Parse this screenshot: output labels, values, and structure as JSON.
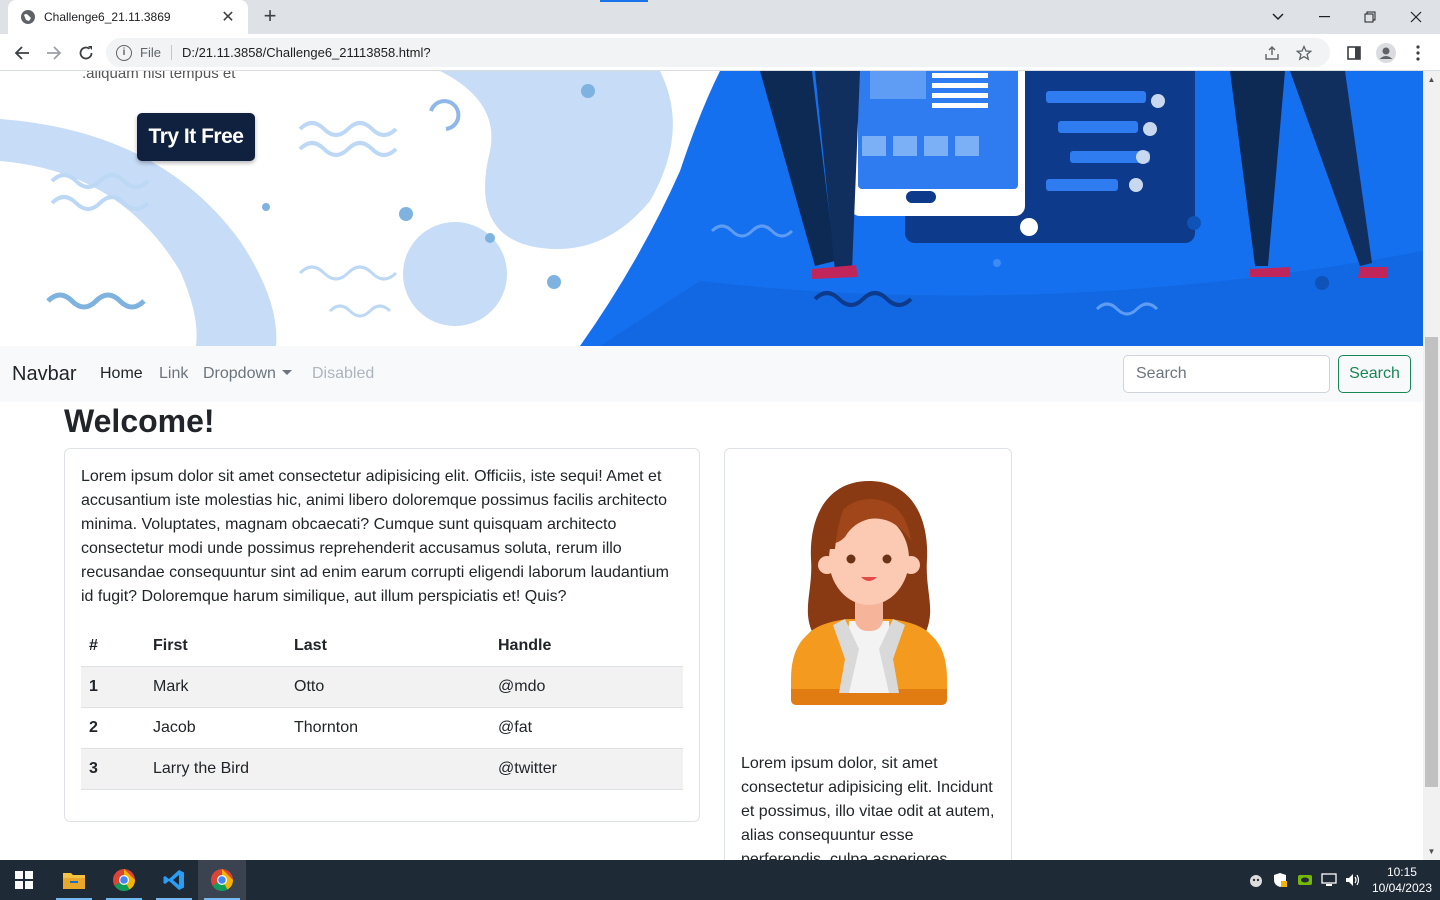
{
  "browser": {
    "tab_title": "Challenge6_21.11.3869",
    "scheme_label": "File",
    "url": "D:/21.11.3858/Challenge6_21113858.html?"
  },
  "hero": {
    "cut_text": ".aliquam nisi tempus et",
    "cta_label": "Try It Free"
  },
  "navbar": {
    "brand": "Navbar",
    "links": [
      {
        "label": "Home",
        "state": "active"
      },
      {
        "label": "Link",
        "state": "normal"
      },
      {
        "label": "Dropdown",
        "state": "dropdown"
      },
      {
        "label": "Disabled",
        "state": "disabled"
      }
    ],
    "search_placeholder": "Search",
    "search_button": "Search"
  },
  "main": {
    "heading": "Welcome!",
    "card_text": "Lorem ipsum dolor sit amet consectetur adipisicing elit. Officiis, iste sequi! Amet et accusantium iste molestias hic, animi libero doloremque possimus facilis architecto minima. Voluptates, magnam obcaecati? Cumque sunt quisquam architecto consectetur modi unde possimus reprehenderit accusamus soluta, rerum illo recusandae consequuntur sint ad enim earum corrupti eligendi laborum laudantium id fugit? Doloremque harum similique, aut illum perspiciatis et! Quis?",
    "table": {
      "headers": [
        "#",
        "First",
        "Last",
        "Handle"
      ],
      "rows": [
        [
          "1",
          "Mark",
          "Otto",
          "@mdo"
        ],
        [
          "2",
          "Jacob",
          "Thornton",
          "@fat"
        ],
        [
          "3",
          "Larry the Bird",
          "",
          "@twitter"
        ]
      ]
    },
    "side_text": "Lorem ipsum dolor, sit amet consectetur adipisicing elit. Incidunt et possimus, illo vitae odit at autem, alias consequuntur esse perferendis, culpa asperiores"
  },
  "taskbar": {
    "time": "10:15",
    "date": "10/04/2023"
  },
  "colors": {
    "hero_blue": "#1570f0",
    "accent_success": "#198754",
    "taskbar": "#1f2a37"
  }
}
